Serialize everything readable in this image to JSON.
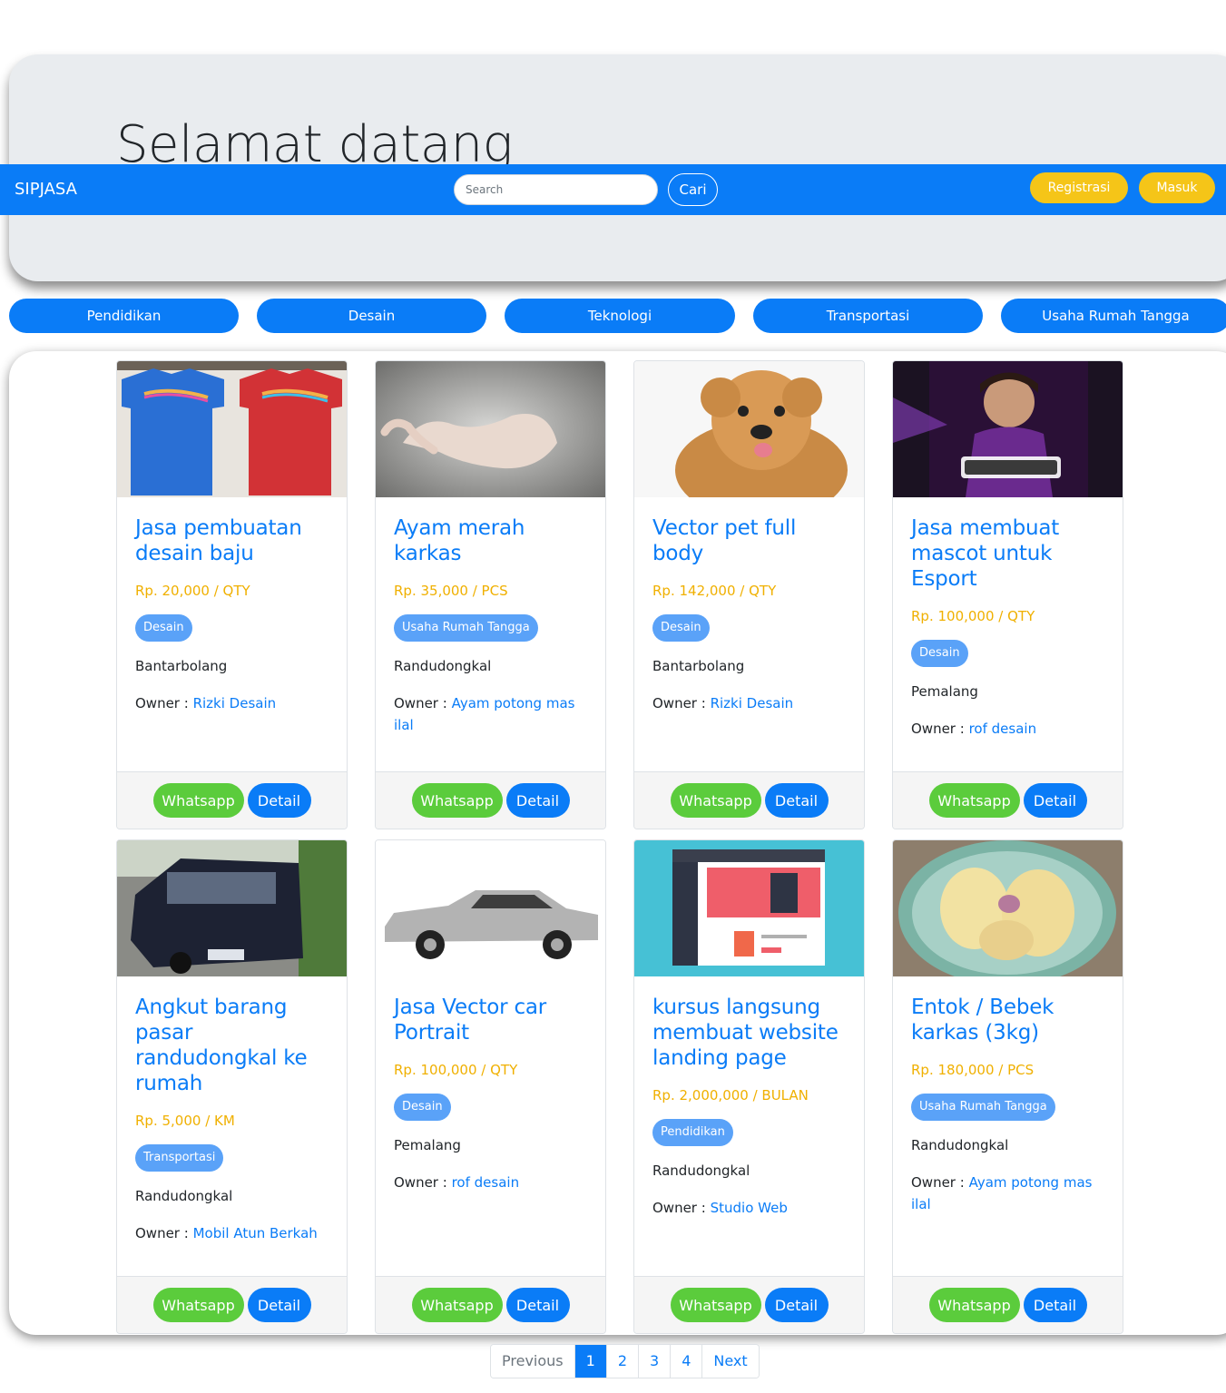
{
  "jumbotron": {
    "title": "Selamat datang"
  },
  "navbar": {
    "brand": "SIPJASA",
    "search_placeholder": "Search",
    "search_button": "Cari",
    "register_button": "Registrasi",
    "login_button": "Masuk"
  },
  "categories": [
    "Pendidikan",
    "Desain",
    "Teknologi",
    "Transportasi",
    "Usaha Rumah Tangga"
  ],
  "cards": [
    {
      "title": "Jasa pembuatan desain baju",
      "price": "Rp. 20,000 / QTY",
      "category": "Desain",
      "location": "Bantarbolang",
      "owner_label": "Owner :",
      "owner": "Rizki Desain",
      "image": "t-shirts-image"
    },
    {
      "title": "Ayam merah karkas",
      "price": "Rp. 35,000 / PCS",
      "category": "Usaha Rumah Tangga",
      "location": "Randudongkal",
      "owner_label": "Owner :",
      "owner": "Ayam potong mas ilal",
      "image": "chicken-image"
    },
    {
      "title": "Vector pet full body",
      "price": "Rp. 142,000 / QTY",
      "category": "Desain",
      "location": "Bantarbolang",
      "owner_label": "Owner :",
      "owner": "Rizki Desain",
      "image": "dog-image"
    },
    {
      "title": "Jasa membuat mascot untuk Esport",
      "price": "Rp. 100,000 / QTY",
      "category": "Desain",
      "location": "Pemalang",
      "owner_label": "Owner :",
      "owner": "rof desain",
      "image": "starlord-mascot-image"
    },
    {
      "title": "Angkut barang pasar randudongkal ke rumah",
      "price": "Rp. 5,000 / KM",
      "category": "Transportasi",
      "location": "Randudongkal",
      "owner_label": "Owner :",
      "owner": "Mobil Atun Berkah",
      "image": "van-image"
    },
    {
      "title": "Jasa Vector car Portrait",
      "price": "Rp. 100,000 / QTY",
      "category": "Desain",
      "location": "Pemalang",
      "owner_label": "Owner :",
      "owner": "rof desain",
      "image": "car-vector-image"
    },
    {
      "title": "kursus langsung membuat website landing page",
      "price": "Rp. 2,000,000 / BULAN",
      "category": "Pendidikan",
      "location": "Randudongkal",
      "owner_label": "Owner :",
      "owner": "Studio Web",
      "image": "website-mockup-image"
    },
    {
      "title": "Entok / Bebek karkas (3kg)",
      "price": "Rp. 180,000 / PCS",
      "category": "Usaha Rumah Tangga",
      "location": "Randudongkal",
      "owner_label": "Owner :",
      "owner": "Ayam potong mas ilal",
      "image": "duck-image"
    }
  ],
  "card_buttons": {
    "whatsapp": "Whatsapp",
    "detail": "Detail"
  },
  "pagination": {
    "previous": "Previous",
    "pages": [
      "1",
      "2",
      "3",
      "4"
    ],
    "next": "Next",
    "active_page": "1"
  }
}
